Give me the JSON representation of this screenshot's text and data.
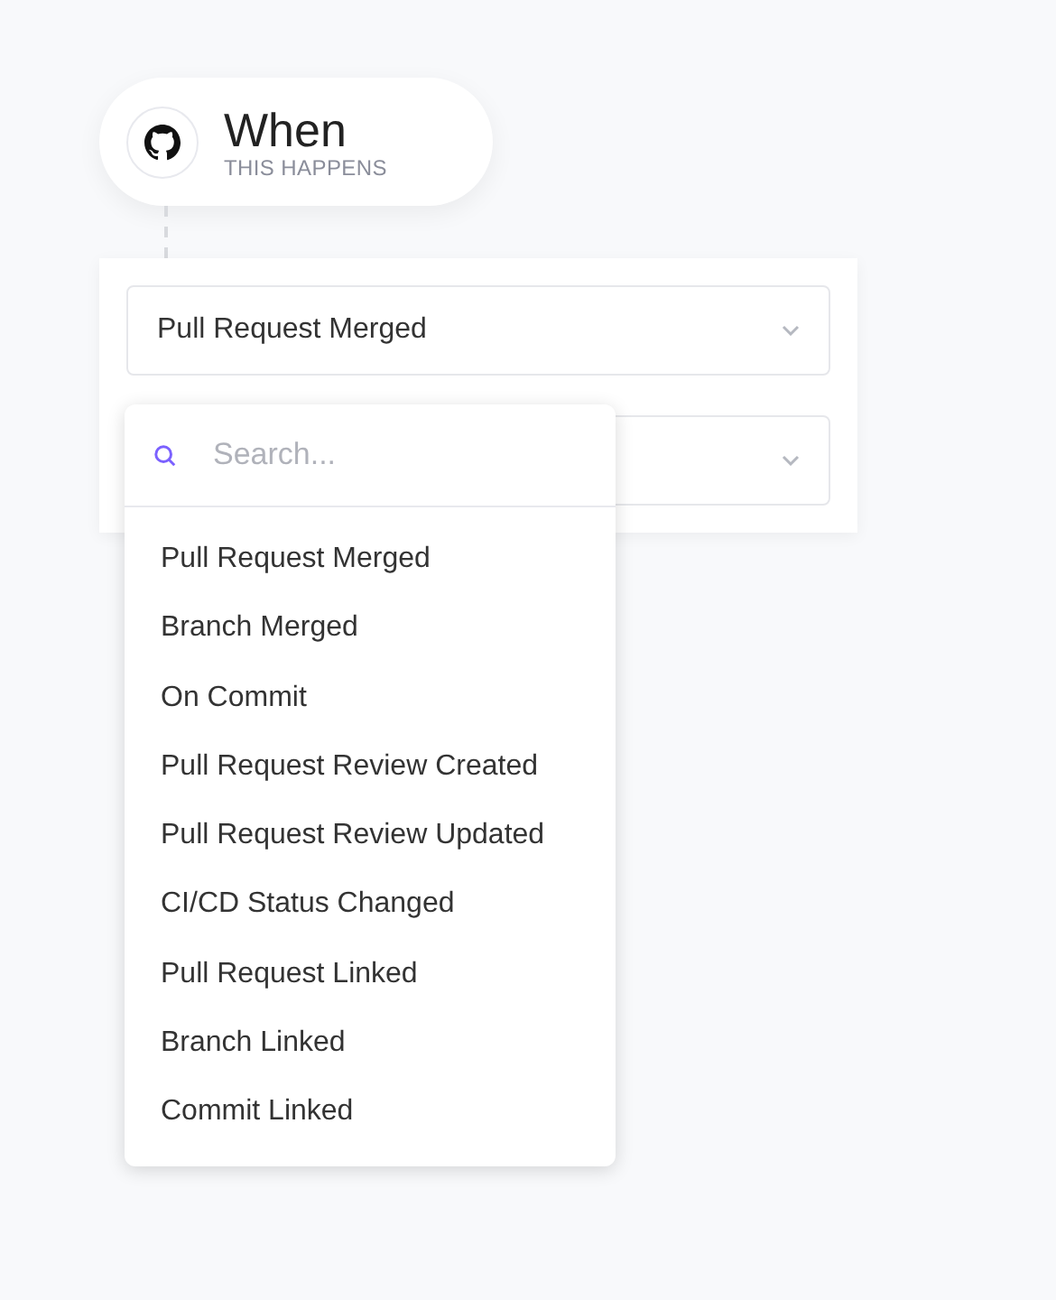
{
  "trigger": {
    "title": "When",
    "subtitle": "THIS HAPPENS"
  },
  "event_select": {
    "value": "Pull Request Merged"
  },
  "dropdown": {
    "search": {
      "placeholder": "Search..."
    },
    "options": [
      "Pull Request Merged",
      "Branch Merged",
      "On Commit",
      "Pull Request Review Created",
      "Pull Request Review Updated",
      "CI/CD Status Changed",
      "Pull Request Linked",
      "Branch Linked",
      "Commit Linked"
    ]
  }
}
